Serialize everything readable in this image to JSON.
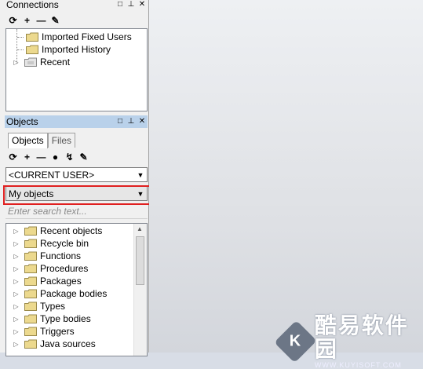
{
  "connections": {
    "title": "Connections",
    "items": [
      {
        "label": "Imported Fixed Users"
      },
      {
        "label": "Imported History"
      },
      {
        "label": "Recent"
      }
    ]
  },
  "objects": {
    "title": "Objects",
    "tabs": [
      {
        "label": "Objects"
      },
      {
        "label": "Files"
      }
    ],
    "user_select": "<CURRENT USER>",
    "filter_select": "My objects",
    "search_placeholder": "Enter search text...",
    "items": [
      {
        "label": "Recent objects"
      },
      {
        "label": "Recycle bin"
      },
      {
        "label": "Functions"
      },
      {
        "label": "Procedures"
      },
      {
        "label": "Packages"
      },
      {
        "label": "Package bodies"
      },
      {
        "label": "Types"
      },
      {
        "label": "Type bodies"
      },
      {
        "label": "Triggers"
      },
      {
        "label": "Java sources"
      }
    ]
  },
  "watermark": {
    "logo": "K",
    "title": "酷易软件园",
    "sub": "WWW.KUYISOFT.COM"
  },
  "colors": {
    "highlight": "#e02020",
    "active_header": "#b9d1ea",
    "folder": "#e8d890"
  }
}
